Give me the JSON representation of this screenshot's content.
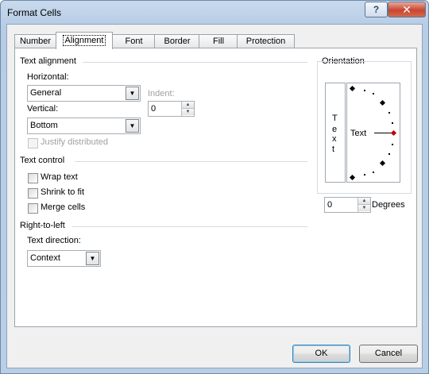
{
  "window": {
    "title": "Format Cells",
    "help_glyph": "?",
    "close_glyph": "✕"
  },
  "tabs": [
    {
      "label": "Number",
      "active": false
    },
    {
      "label": "Alignment",
      "active": true
    },
    {
      "label": "Font",
      "active": false
    },
    {
      "label": "Border",
      "active": false
    },
    {
      "label": "Fill",
      "active": false
    },
    {
      "label": "Protection",
      "active": false
    }
  ],
  "text_alignment": {
    "heading": "Text alignment",
    "horizontal_label": "Horizontal:",
    "horizontal_value": "General",
    "vertical_label": "Vertical:",
    "vertical_value": "Bottom",
    "indent_label": "Indent:",
    "indent_value": "0",
    "justify_distributed": {
      "label": "Justify distributed",
      "checked": false,
      "enabled": false
    }
  },
  "text_control": {
    "heading": "Text control",
    "wrap_text": {
      "label": "Wrap text",
      "checked": false
    },
    "shrink_to_fit": {
      "label": "Shrink to fit",
      "checked": false
    },
    "merge_cells": {
      "label": "Merge cells",
      "checked": false
    }
  },
  "right_to_left": {
    "heading": "Right-to-left",
    "text_direction_label": "Text direction:",
    "text_direction_value": "Context"
  },
  "orientation": {
    "heading": "Orientation",
    "vertical_text_letters": [
      "T",
      "e",
      "x",
      "t"
    ],
    "dial_text": "Text",
    "degrees_value": "0",
    "degrees_label": "Degrees"
  },
  "buttons": {
    "ok": "OK",
    "cancel": "Cancel"
  },
  "colors": {
    "title_bar": "#b9cfe7",
    "close_button": "#c9442e",
    "dial_indicator": "#c00000",
    "default_button_border": "#3c7fb1"
  }
}
